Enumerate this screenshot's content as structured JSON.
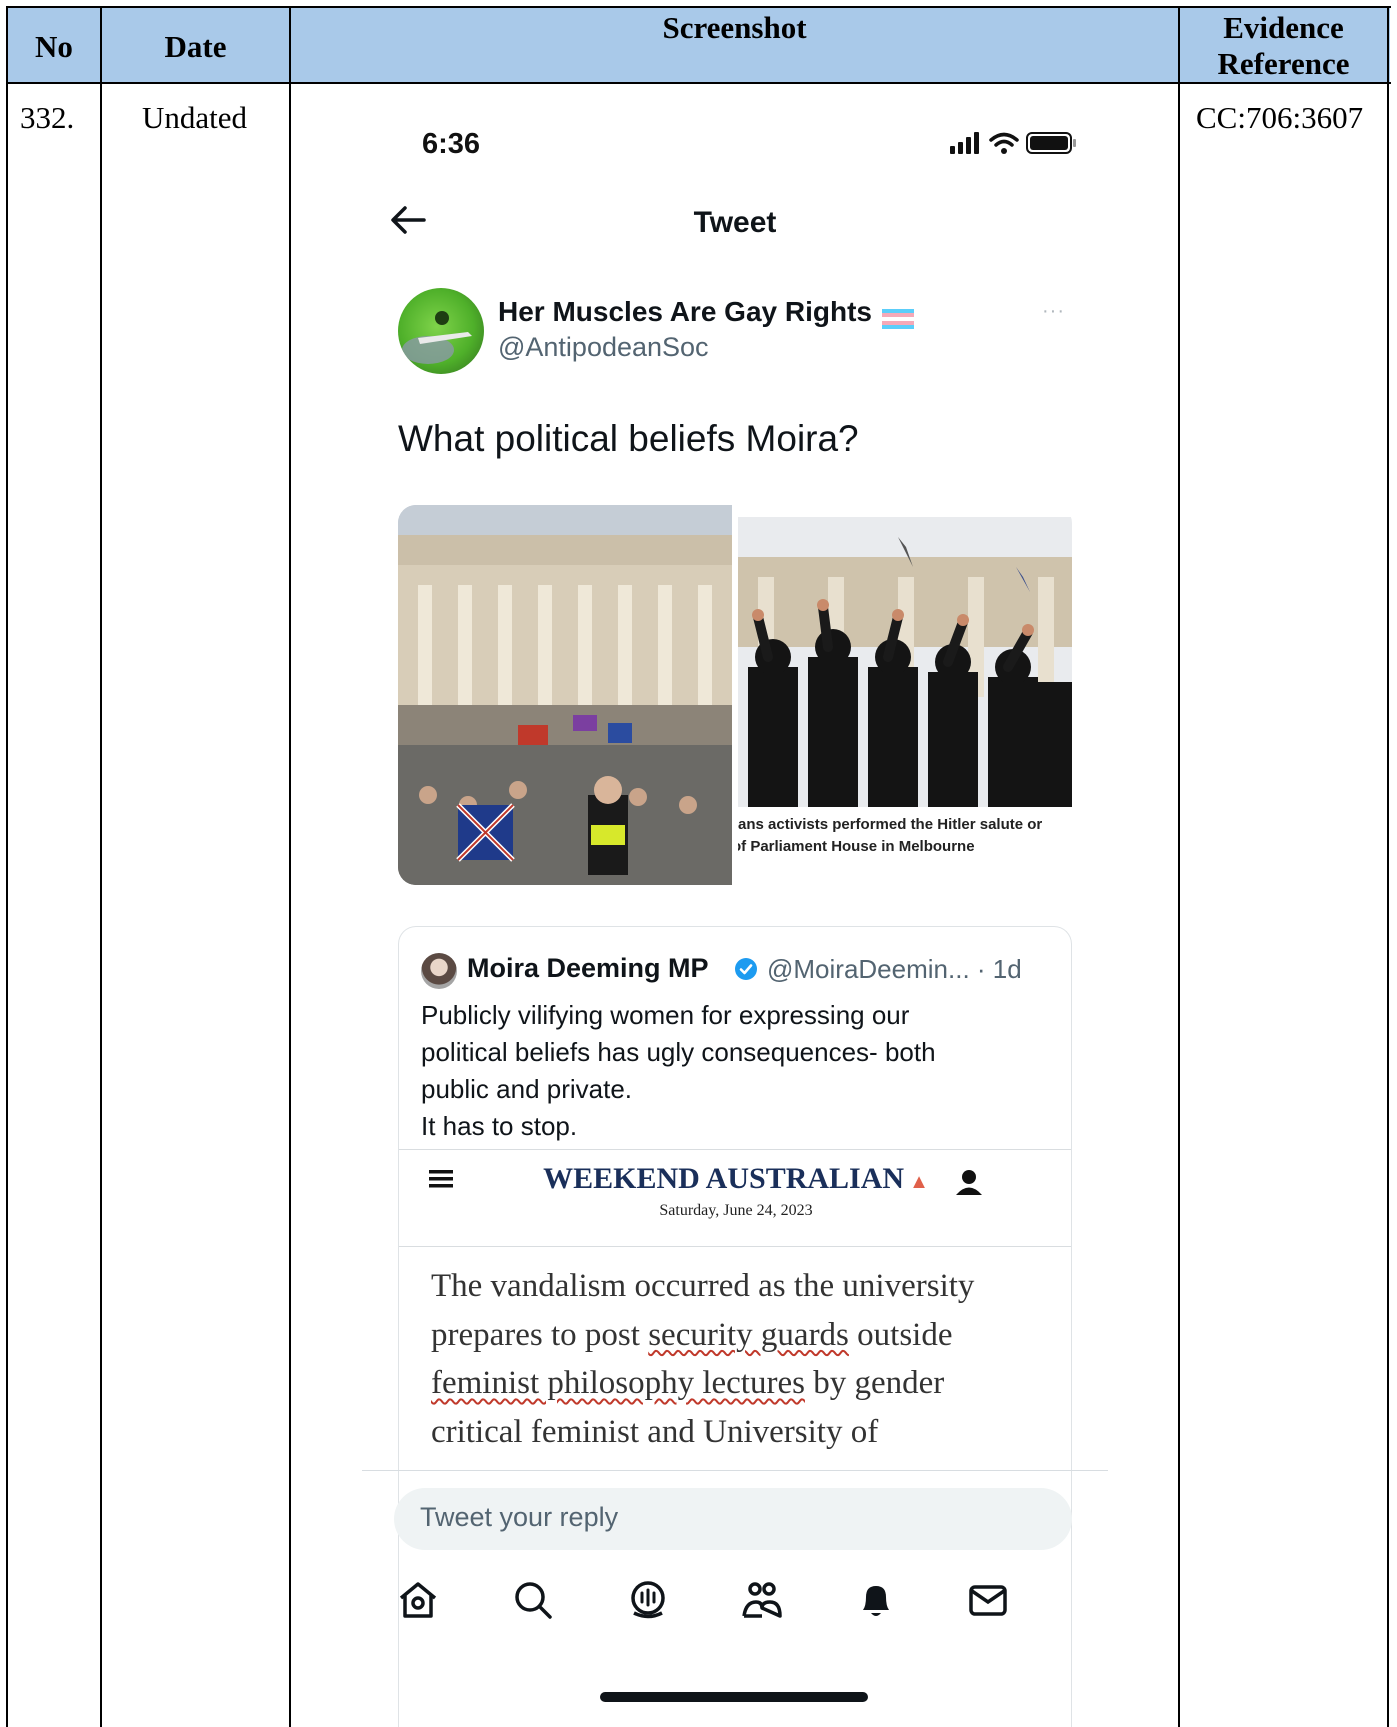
{
  "table": {
    "headers": {
      "no": "No",
      "date": "Date",
      "screenshot": "Screenshot",
      "evidence_line1": "Evidence",
      "evidence_line2": "Reference"
    },
    "row": {
      "no": "332.",
      "date": "Undated",
      "evidence": "CC:706:3607"
    }
  },
  "phone": {
    "status_time": "6:36",
    "nav_title": "Tweet",
    "tweet": {
      "display_name": "Her Muscles Are Gay Rights",
      "handle": "@AntipodeanSoc",
      "more": "···",
      "text": "What political beliefs Moira?",
      "image_caption_line1": "ans activists performed the Hitler salute or",
      "image_caption_line2": "of Parliament House in Melbourne"
    },
    "quote": {
      "name": "Moira Deeming MP",
      "handle": "@MoiraDeemin... · 1d",
      "text_lines": [
        "Publicly vilifying women for expressing our",
        "political beliefs has ugly consequences- both",
        "public and private.",
        "It has to stop."
      ],
      "article": {
        "masthead": "WEEKEND AUSTRALIAN",
        "date": "Saturday, June 24, 2023",
        "line1": "The vandalism occurred as the university",
        "line2_a": "prepares to post ",
        "line2_link": "security guards",
        "line2_b": " outside",
        "line3_link": "feminist philosophy lectures",
        "line3_b": " by gender",
        "line4": "critical feminist and University of"
      }
    },
    "reply_placeholder": "Tweet your reply",
    "tabs": [
      "home-icon",
      "search-icon",
      "spaces-icon",
      "communities-icon",
      "notifications-icon",
      "messages-icon"
    ]
  }
}
